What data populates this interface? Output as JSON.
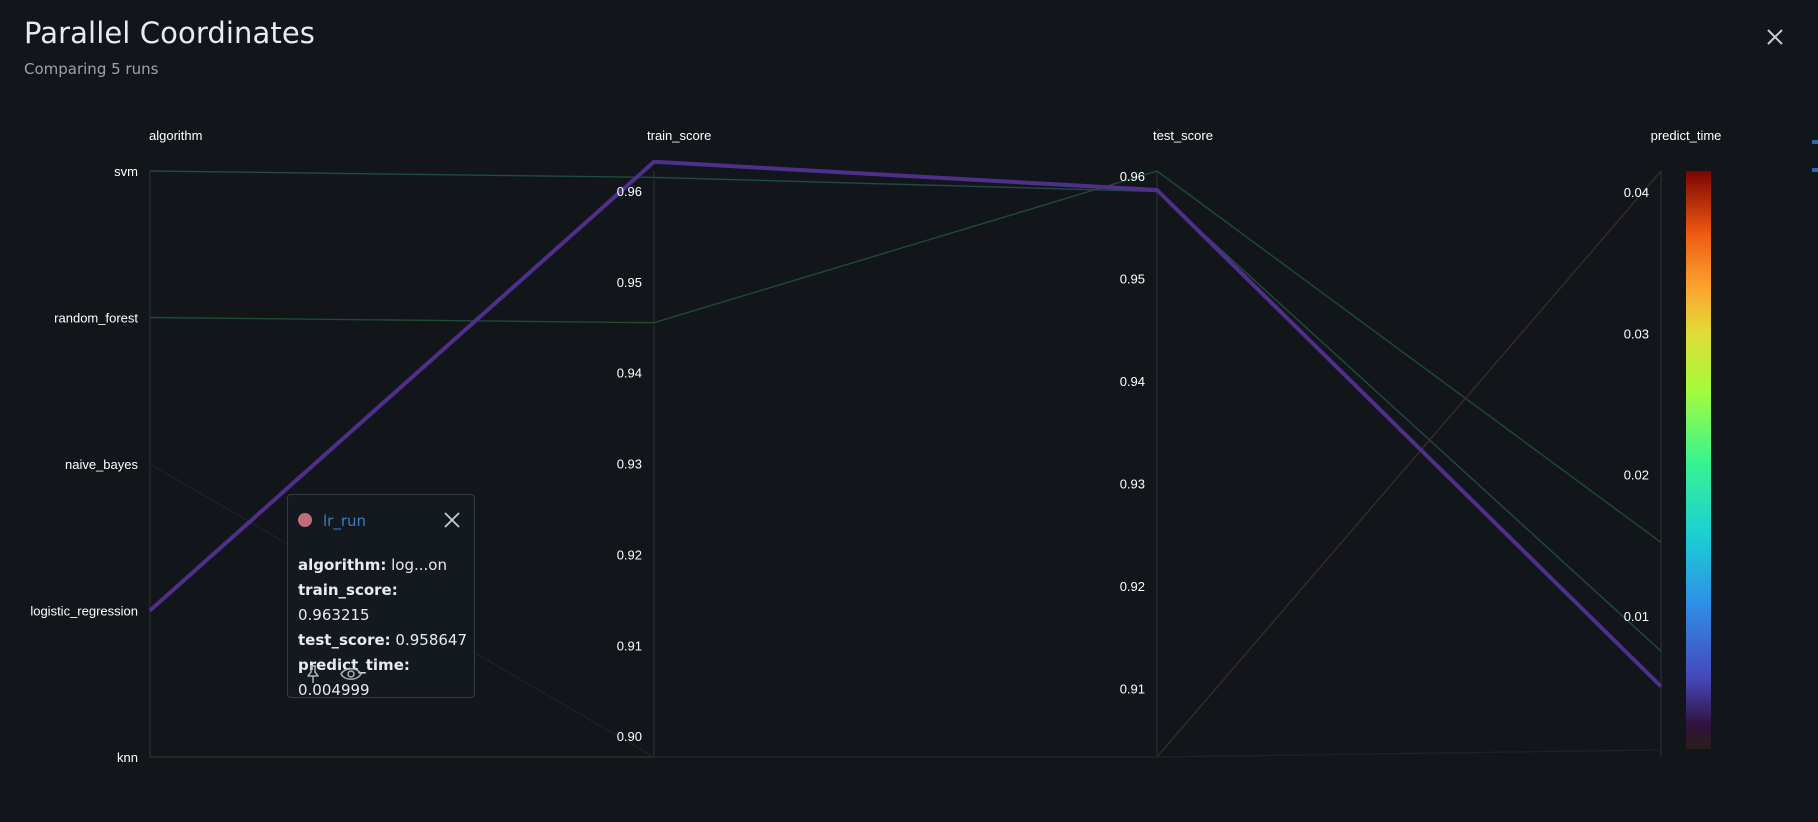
{
  "header": {
    "title": "Parallel Coordinates",
    "subtitle": "Comparing 5 runs"
  },
  "chart_data": {
    "type": "parallel_coordinates",
    "dimensions": [
      {
        "name": "algorithm",
        "kind": "categorical",
        "categories": [
          "svm",
          "random_forest",
          "naive_bayes",
          "logistic_regression",
          "knn"
        ]
      },
      {
        "name": "train_score",
        "kind": "numeric",
        "range": [
          0.8977,
          0.9622
        ],
        "ticks": [
          "0.90",
          "0.91",
          "0.92",
          "0.93",
          "0.94",
          "0.95",
          "0.96"
        ]
      },
      {
        "name": "test_score",
        "kind": "numeric",
        "range": [
          0.9033,
          0.9605
        ],
        "ticks": [
          "0.91",
          "0.92",
          "0.93",
          "0.94",
          "0.95",
          "0.96"
        ]
      },
      {
        "name": "predict_time",
        "kind": "numeric",
        "range": [
          0.0,
          0.0415
        ],
        "ticks": [
          "0.01",
          "0.02",
          "0.03",
          "0.04"
        ],
        "colorscale": "turbo"
      }
    ],
    "runs": [
      {
        "algorithm": "svm",
        "train_score": 0.9615,
        "test_score": 0.9585,
        "predict_time": 0.0075,
        "color": "#1f4a45"
      },
      {
        "algorithm": "random_forest",
        "train_score": 0.9455,
        "test_score": 0.9605,
        "predict_time": 0.0152,
        "color": "#1f4a33"
      },
      {
        "algorithm": "logistic_regression",
        "train_score": 0.963215,
        "test_score": 0.958647,
        "predict_time": 0.004999,
        "color": "#4e2f8a",
        "highlighted": true
      },
      {
        "algorithm": "knn",
        "train_score": 0.8977,
        "test_score": 0.9033,
        "predict_time": 0.0415,
        "color": "#3a2a24"
      },
      {
        "algorithm": "naive_bayes",
        "train_score": 0.8977,
        "test_score": 0.9033,
        "predict_time": 0.0005,
        "color": "#1c2126"
      }
    ]
  },
  "tooltip": {
    "run_name": "lr_run",
    "dot_color": "#c26b7a",
    "rows": [
      {
        "key": "algorithm:",
        "value": "log...on"
      },
      {
        "key": "train_score:",
        "value": "0.963215"
      },
      {
        "key": "test_score:",
        "value": "0.958647"
      },
      {
        "key": "predict_time:",
        "value": "0.004999"
      }
    ],
    "icons": [
      "pin-icon",
      "eye-icon"
    ]
  }
}
